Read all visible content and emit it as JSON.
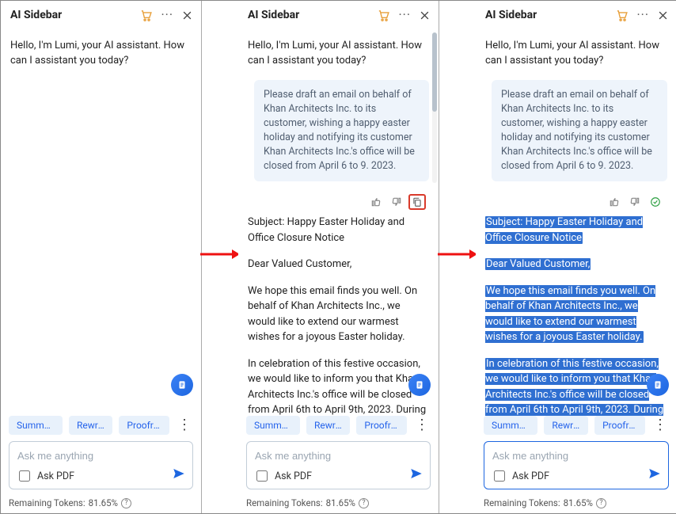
{
  "title": "AI Sidebar",
  "greeting": "Hello, I'm Lumi, your AI assistant. How can I assistant you today?",
  "user_prompt": "Please draft an email on behalf of Khan Architects Inc. to its customer, wishing a happy easter holiday and notifying its customer Khan Architects Inc.'s office will be closed from April 6 to 9. 2023.",
  "reply": {
    "subject_label": "Subject: Happy Easter Holiday and Office Closure Notice",
    "salutation": "Dear Valued Customer,",
    "p1": "We hope this email finds you well. On behalf of Khan Architects Inc., we would like to extend our warmest wishes for a joyous Easter holiday.",
    "p2": "In celebration of this festive occasion, we would like to inform you that Khan Architects Inc.'s office will be closed from April 6th to April 9th, 2023. During this time, our team will be taking a well-deserved break to spend quality time"
  },
  "chips": {
    "summarize": "Summar...",
    "rewrite": "Rewrite",
    "proofread": "Proofre..."
  },
  "input": {
    "placeholder": "Ask me anything",
    "ask_pdf_label": "Ask PDF"
  },
  "footer": {
    "label": "Remaining Tokens:",
    "value": "81.65%"
  }
}
